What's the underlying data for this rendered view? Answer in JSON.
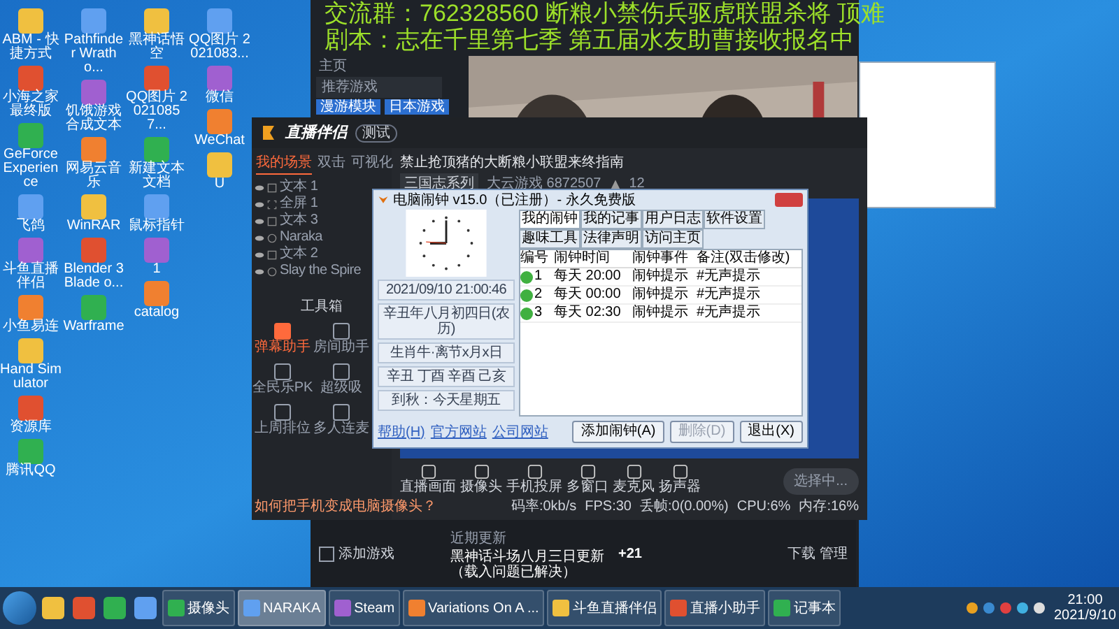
{
  "desktop": {
    "columns": [
      [
        {
          "label": "ABM - 快捷方式"
        },
        {
          "label": "小海之家最终版"
        },
        {
          "label": "GeForce Experience"
        },
        {
          "label": "飞鸽"
        },
        {
          "label": "斗鱼直播伴侣"
        },
        {
          "label": "小鱼易连"
        },
        {
          "label": "Hand Simulator"
        },
        {
          "label": "资源库"
        },
        {
          "label": "腾讯QQ"
        }
      ],
      [
        {
          "label": "Pathfinder Wrath o..."
        },
        {
          "label": "饥饿游戏合成文本"
        },
        {
          "label": "网易云音乐"
        },
        {
          "label": "WinRAR"
        },
        {
          "label": "Blender 3 Blade o..."
        },
        {
          "label": "Warframe"
        }
      ],
      [
        {
          "label": "黑神话悟空"
        },
        {
          "label": "QQ图片 20210857..."
        },
        {
          "label": "新建文本文档"
        },
        {
          "label": "鼠标指针"
        },
        {
          "label": "1"
        },
        {
          "label": "catalog"
        }
      ],
      [
        {
          "label": "QQ图片 2021083..."
        },
        {
          "label": "微信"
        },
        {
          "label": "WeChat"
        },
        {
          "label": "U"
        }
      ]
    ]
  },
  "overlay": {
    "lines": [
      "交流群：762328560 断粮小禁伤兵驱虎联盟杀将 顶难",
      "剧本：志在千里第七季 第五届水友助曹接收报名中"
    ]
  },
  "browser": {
    "home": "主页",
    "search": "推荐游戏",
    "tags": [
      "漫游模块",
      "日本游戏"
    ]
  },
  "companion": {
    "logo": "直播伴侣",
    "badge": "测试",
    "tabs": [
      {
        "label": "我的场景",
        "selected": true
      },
      {
        "label": "双击",
        "selected": false
      },
      {
        "label": "可视化",
        "selected": false
      }
    ],
    "sources": [
      {
        "label": "文本 1",
        "kind": "text",
        "visible": true
      },
      {
        "label": "全屏 1",
        "kind": "screen",
        "visible": true
      },
      {
        "label": "文本 3",
        "kind": "text",
        "visible": true
      },
      {
        "label": "Naraka",
        "kind": "game",
        "visible": true
      },
      {
        "label": "文本 2",
        "kind": "text",
        "visible": true
      },
      {
        "label": "Slay the Spire",
        "kind": "game",
        "visible": true
      }
    ],
    "stream_title": "禁止抢顶猪的大断粮小联盟来终指南",
    "category": "三国志系列",
    "room": "大云游戏 6872507",
    "viewers": "12",
    "toolbox_title": "工具箱",
    "tools": [
      {
        "label": "弹幕助手",
        "active": true
      },
      {
        "label": "房间助手",
        "active": false
      },
      {
        "label": "全民乐PK",
        "active": false
      },
      {
        "label": "超级吸",
        "active": false
      },
      {
        "label": "上周排位",
        "active": false
      },
      {
        "label": "多人连麦",
        "active": false
      }
    ],
    "tip": "如何把手机变成电脑摄像头？",
    "controls": [
      "直播画面",
      "摄像头",
      "手机投屏",
      "多窗口",
      "麦克风",
      "扬声器"
    ],
    "start": "选择中...",
    "stats": [
      "码率:0kb/s",
      "FPS:30",
      "丢帧:0(0.00%)",
      "CPU:6%",
      "内存:16%"
    ],
    "add_game": "添加游戏"
  },
  "news": {
    "tag": "近期更新",
    "headline": "黑神话斗场八月三日更新（载入问题已解决）",
    "more": "+21",
    "download": "下载 管理"
  },
  "alarm": {
    "title": "电脑闹钟 v15.0（已注册）- 永久免费版",
    "tabs": [
      {
        "label": "我的闹钟",
        "selected": true
      },
      {
        "label": "我的记事",
        "selected": false
      },
      {
        "label": "用户日志",
        "selected": false
      },
      {
        "label": "软件设置",
        "selected": false
      },
      {
        "label": "趣味工具",
        "selected": false
      },
      {
        "label": "法律声明",
        "selected": false
      },
      {
        "label": "访问主页",
        "selected": false
      }
    ],
    "columns": [
      "编号",
      "闹钟时间",
      "闹钟事件",
      "备注(双击修改)"
    ],
    "rows": [
      {
        "no": "1",
        "time": "每天 20:00",
        "event": "闹钟提示",
        "note": "#无声提示",
        "enabled": true
      },
      {
        "no": "2",
        "time": "每天 00:00",
        "event": "闹钟提示",
        "note": "#无声提示",
        "enabled": true
      },
      {
        "no": "3",
        "time": "每天 02:30",
        "event": "闹钟提示",
        "note": "#无声提示",
        "enabled": true
      }
    ],
    "info": [
      "2021/09/10 21:00:46",
      "辛丑年八月初四日(农历)",
      "生肖牛·离节x月x日",
      "辛丑 丁酉 辛酉 己亥",
      "到秋：今天星期五"
    ],
    "links": [
      "帮助(H)",
      "官方网站",
      "公司网站"
    ],
    "buttons": [
      {
        "label": "添加闹钟(A)",
        "disabled": false
      },
      {
        "label": "删除(D)",
        "disabled": true
      },
      {
        "label": "退出(X)",
        "disabled": false
      }
    ]
  },
  "taskbar": {
    "tasks": [
      {
        "label": "摄像头",
        "active": false
      },
      {
        "label": "NARAKA",
        "active": true
      },
      {
        "label": "Steam",
        "active": false
      },
      {
        "label": "Variations On A ...",
        "active": false
      },
      {
        "label": "斗鱼直播伴侣",
        "active": false
      },
      {
        "label": "直播小助手",
        "active": false
      },
      {
        "label": "记事本",
        "active": false
      }
    ],
    "time": "21:00",
    "date": "2021/9/10"
  }
}
